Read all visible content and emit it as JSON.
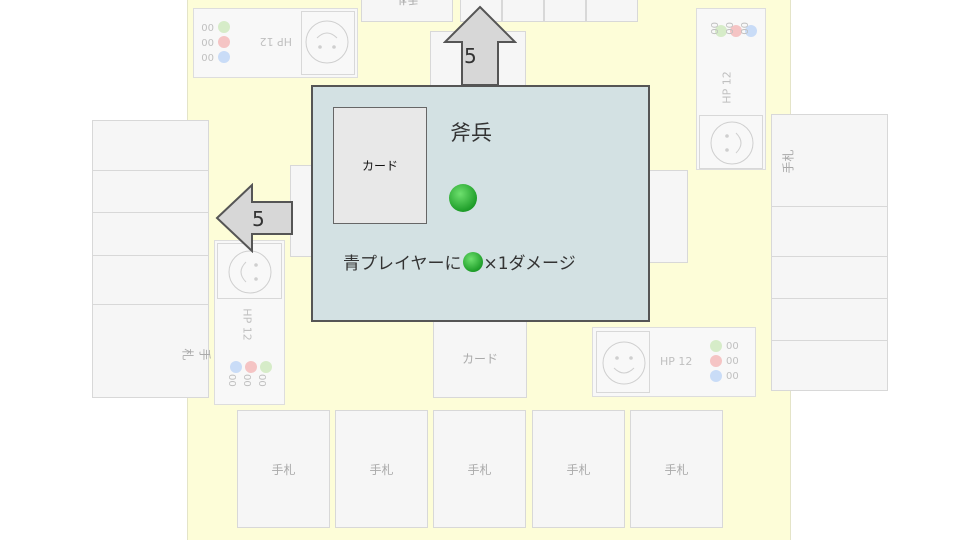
{
  "hand_label": "手札",
  "card_label": "カード",
  "players": {
    "top_left": {
      "hp": "HP 12",
      "res": [
        "00",
        "00",
        "00"
      ]
    },
    "top_right": {
      "hp": "HP 12",
      "res": [
        "00",
        "00",
        "00"
      ]
    },
    "left": {
      "hp": "HP 12",
      "res": [
        "00",
        "00",
        "00"
      ]
    },
    "bottom_right": {
      "hp": "HP 12",
      "res": [
        "00",
        "00",
        "00"
      ]
    }
  },
  "arrows": {
    "up_value": "5",
    "left_value": "5"
  },
  "popup": {
    "card_label": "カード",
    "title": "斧兵",
    "desc_before": "青プレイヤーに",
    "desc_after": "×1ダメージ"
  },
  "colors": {
    "table": "#fdfdd8",
    "popup": "#d3e1e3",
    "gem": "#2aa336",
    "blue": "#c9dcf7",
    "red": "#f5c4c4",
    "green": "#d6ecc8"
  }
}
